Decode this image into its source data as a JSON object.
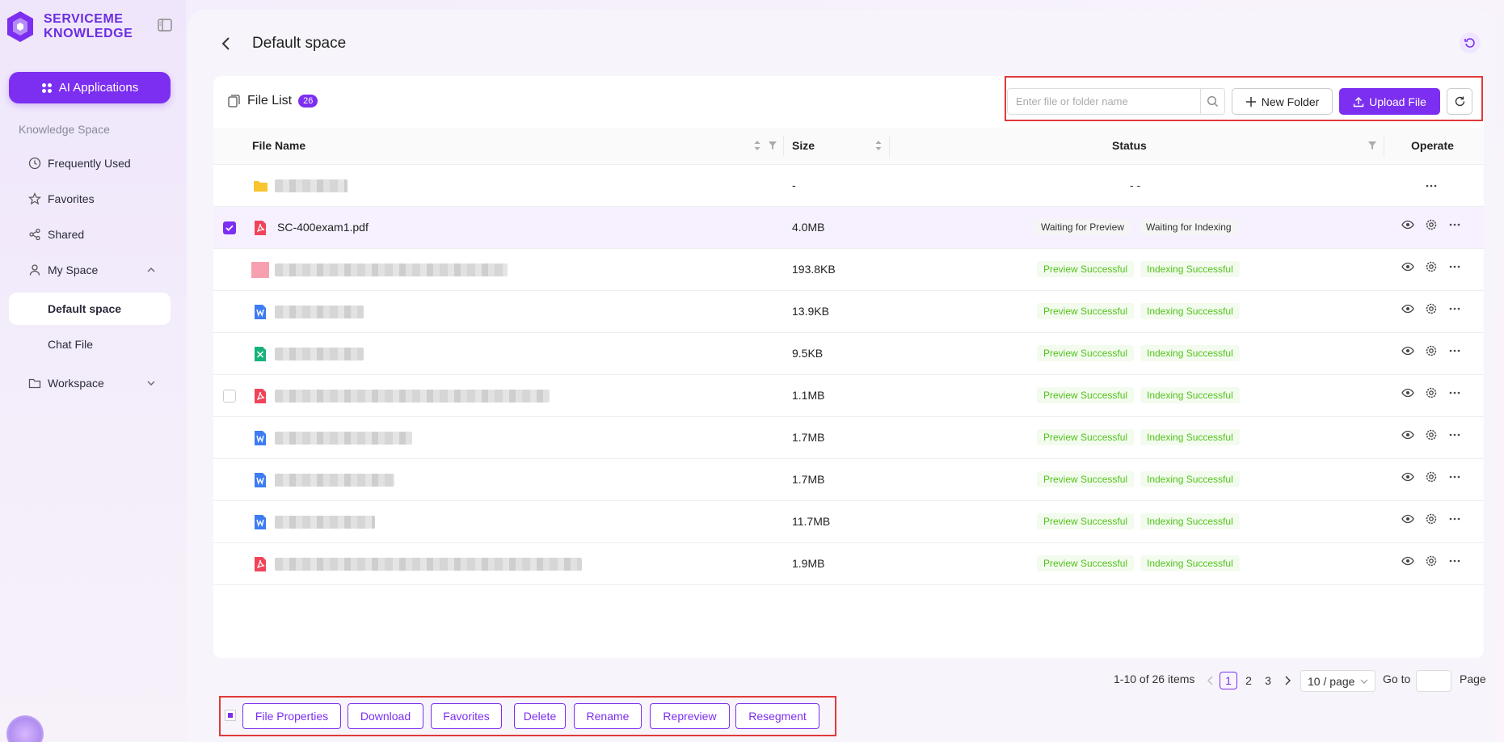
{
  "brand": {
    "line1": "SERVICEME",
    "line2": "KNOWLEDGE"
  },
  "sidebar": {
    "ai_button": "AI Applications",
    "section_label": "Knowledge Space",
    "items": [
      {
        "label": "Frequently Used",
        "icon": "clock-icon"
      },
      {
        "label": "Favorites",
        "icon": "star-icon"
      },
      {
        "label": "Shared",
        "icon": "share-icon"
      },
      {
        "label": "My Space",
        "icon": "user-icon"
      },
      {
        "label": "Default space"
      },
      {
        "label": "Chat File"
      },
      {
        "label": "Workspace",
        "icon": "folder-icon"
      }
    ]
  },
  "header": {
    "title": "Default space"
  },
  "file_list": {
    "title": "File List",
    "count": "26",
    "search_placeholder": "Enter file or folder name",
    "new_folder": "New Folder",
    "upload_file": "Upload File"
  },
  "table": {
    "columns": {
      "name": "File Name",
      "size": "Size",
      "status": "Status",
      "operate": "Operate"
    },
    "rows": [
      {
        "type": "folder",
        "name": "",
        "size": "-",
        "status": "- -",
        "checked": false,
        "selected": false
      },
      {
        "type": "pdf",
        "name": "SC-400exam1.pdf",
        "size": "4.0MB",
        "preview": "Waiting for Preview",
        "indexing": "Waiting for Indexing",
        "checked": true,
        "selected": true
      },
      {
        "type": "img",
        "name": "",
        "size": "193.8KB",
        "preview": "Preview Successful",
        "indexing": "Indexing Successful"
      },
      {
        "type": "word",
        "name": "",
        "size": "13.9KB",
        "preview": "Preview Successful",
        "indexing": "Indexing Successful"
      },
      {
        "type": "excel",
        "name": "",
        "size": "9.5KB",
        "preview": "Preview Successful",
        "indexing": "Indexing Successful"
      },
      {
        "type": "pdf",
        "name": "",
        "size": "1.1MB",
        "preview": "Preview Successful",
        "indexing": "Indexing Successful"
      },
      {
        "type": "word",
        "name": "",
        "size": "1.7MB",
        "preview": "Preview Successful",
        "indexing": "Indexing Successful"
      },
      {
        "type": "word",
        "name": "",
        "size": "1.7MB",
        "preview": "Preview Successful",
        "indexing": "Indexing Successful"
      },
      {
        "type": "word",
        "name": "",
        "size": "11.7MB",
        "preview": "Preview Successful",
        "indexing": "Indexing Successful"
      },
      {
        "type": "pdf",
        "name": "",
        "size": "1.9MB",
        "preview": "Preview Successful",
        "indexing": "Indexing Successful"
      }
    ]
  },
  "pagination": {
    "summary": "1-10 of 26 items",
    "pages": [
      "1",
      "2",
      "3"
    ],
    "page_size": "10 / page",
    "goto_label": "Go to",
    "page_label": "Page"
  },
  "actions": {
    "buttons": [
      "File Properties",
      "Download",
      "Favorites",
      "Delete",
      "Rename",
      "Repreview",
      "Resegment"
    ]
  },
  "colors": {
    "accent": "#7c2ff0",
    "success": "#52c41a",
    "highlight_border": "#e03a3a"
  }
}
